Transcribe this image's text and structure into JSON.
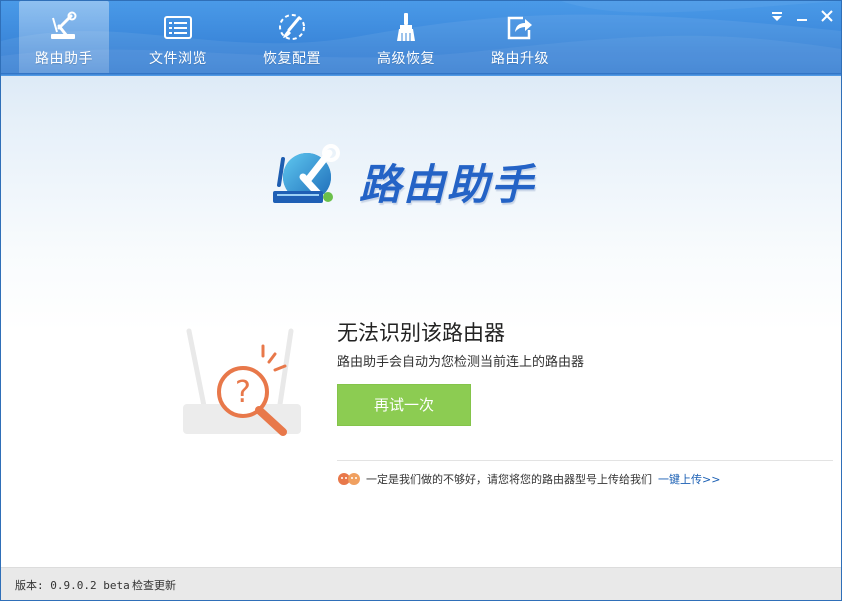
{
  "header": {
    "tabs": [
      {
        "label": "路由助手",
        "icon": "router-wrench-icon",
        "active": true
      },
      {
        "label": "文件浏览",
        "icon": "file-list-icon",
        "active": false
      },
      {
        "label": "恢复配置",
        "icon": "restore-brush-icon",
        "active": false
      },
      {
        "label": "高级恢复",
        "icon": "advanced-brush-icon",
        "active": false
      },
      {
        "label": "路由升级",
        "icon": "share-arrow-icon",
        "active": false
      }
    ],
    "window_controls": [
      "menu-dropdown-icon",
      "minimize-icon",
      "close-icon"
    ]
  },
  "logo": {
    "text": "路由助手"
  },
  "message": {
    "title": "无法识别该路由器",
    "subtitle": "路由助手会自动为您检测当前连上的路由器",
    "retry_label": "再试一次"
  },
  "feedback": {
    "text": "一定是我们做的不够好，请您将您的路由器型号上传给我们",
    "upload_label": "一键上传>>"
  },
  "footer": {
    "version": "版本: 0.9.0.2 beta",
    "check_update": "检查更新"
  },
  "colors": {
    "header_blue": "#3b87da",
    "retry_green": "#8ccc52",
    "magnifier_orange": "#e8784a",
    "link_blue": "#1a5fb4"
  }
}
